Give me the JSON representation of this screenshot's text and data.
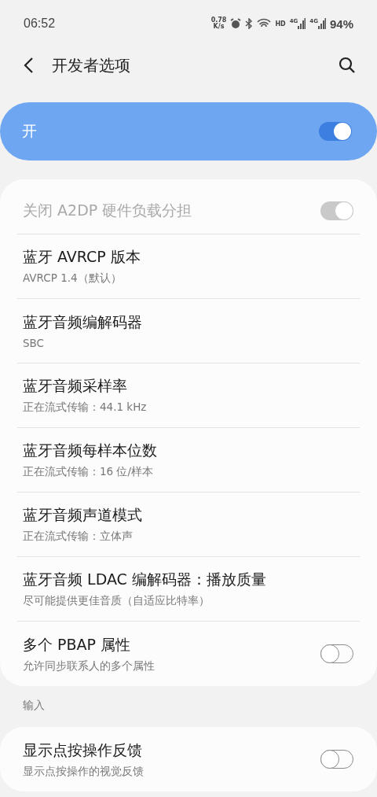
{
  "status_bar": {
    "time": "06:52",
    "speed": [
      "0.78",
      "K/s"
    ],
    "hd": "HD",
    "network": [
      "4G",
      "4G"
    ],
    "battery": "94%"
  },
  "header": {
    "title": "开发者选项"
  },
  "master_switch": {
    "label": "开",
    "on": true
  },
  "settings": [
    {
      "kind": "switch",
      "title": "关闭 A2DP 硬件负载分担",
      "on": true,
      "disabled": true
    },
    {
      "kind": "value",
      "title": "蓝牙 AVRCP 版本",
      "summary": "AVRCP 1.4（默认）"
    },
    {
      "kind": "value",
      "title": "蓝牙音频编解码器",
      "summary": "SBC"
    },
    {
      "kind": "value",
      "title": "蓝牙音频采样率",
      "summary": "正在流式传输：44.1 kHz"
    },
    {
      "kind": "value",
      "title": "蓝牙音频每样本位数",
      "summary": "正在流式传输：16 位/样本"
    },
    {
      "kind": "value",
      "title": "蓝牙音频声道模式",
      "summary": "正在流式传输：立体声"
    },
    {
      "kind": "value",
      "title": "蓝牙音频 LDAC 编解码器：播放质量",
      "summary": "尽可能提供更佳音质（自适应比特率）"
    },
    {
      "kind": "switch",
      "title": "多个 PBAP 属性",
      "summary": "允许同步联系人的多个属性",
      "on": false,
      "disabled": false
    }
  ],
  "section": {
    "title": "输入"
  },
  "input_settings": [
    {
      "kind": "switch",
      "title": "显示点按操作反馈",
      "summary": "显示点按操作的视觉反馈",
      "on": false,
      "disabled": false
    }
  ]
}
